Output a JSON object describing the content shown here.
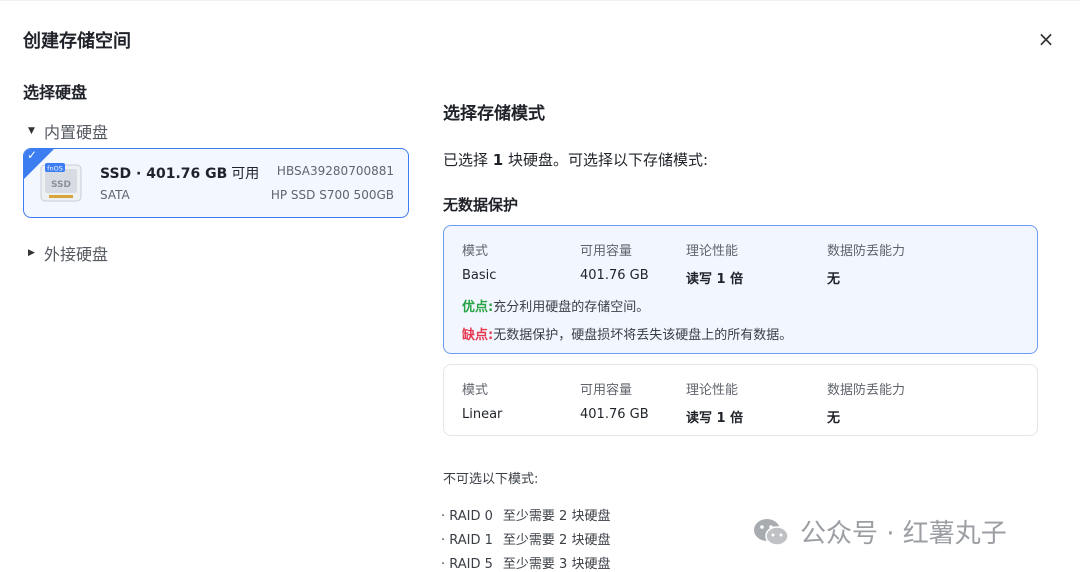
{
  "dialog": {
    "title": "创建存储空间",
    "close_glyph": "×"
  },
  "left": {
    "title": "选择硬盘",
    "groups": [
      {
        "label": "内置硬盘",
        "caret": "▼"
      },
      {
        "label": "外接硬盘",
        "caret": "▶"
      }
    ],
    "disk": {
      "badge": "fnOS",
      "icon_text": "SSD",
      "name": "SSD · 401.76 GB",
      "avail": "可用",
      "type": "SATA",
      "serial": "HBSA39280700881",
      "model": "HP SSD S700 500GB",
      "check": "✓"
    }
  },
  "right": {
    "title": "选择存储模式",
    "selected_prefix": "已选择 ",
    "selected_count": "1",
    "selected_suffix": " 块硬盘。可选择以下存储模式:",
    "section_no_protection": "无数据保护",
    "headers": [
      "模式",
      "可用容量",
      "理论性能",
      "数据防丢能力"
    ],
    "modes": [
      {
        "mode": "Basic",
        "capacity": "401.76 GB",
        "perf": "读写 1 倍",
        "protect": "无",
        "pro_label": "优点:",
        "pro_text": "充分利用硬盘的存储空间。",
        "con_label": "缺点:",
        "con_text": "无数据保护，硬盘损坏将丢失该硬盘上的所有数据。"
      },
      {
        "mode": "Linear",
        "capacity": "401.76 GB",
        "perf": "读写 1 倍",
        "protect": "无"
      }
    ],
    "unavailable_title": "不可选以下模式:",
    "unavailable": [
      {
        "name": "· RAID 0",
        "req": "至少需要 2 块硬盘"
      },
      {
        "name": "· RAID 1",
        "req": "至少需要 2 块硬盘"
      },
      {
        "name": "· RAID 5",
        "req": "至少需要 3 块硬盘"
      }
    ]
  },
  "watermark": {
    "text": "公众号 · 红薯丸子"
  },
  "colors": {
    "accent": "#3d7df2",
    "pro": "#27a343",
    "con": "#e5384f"
  }
}
